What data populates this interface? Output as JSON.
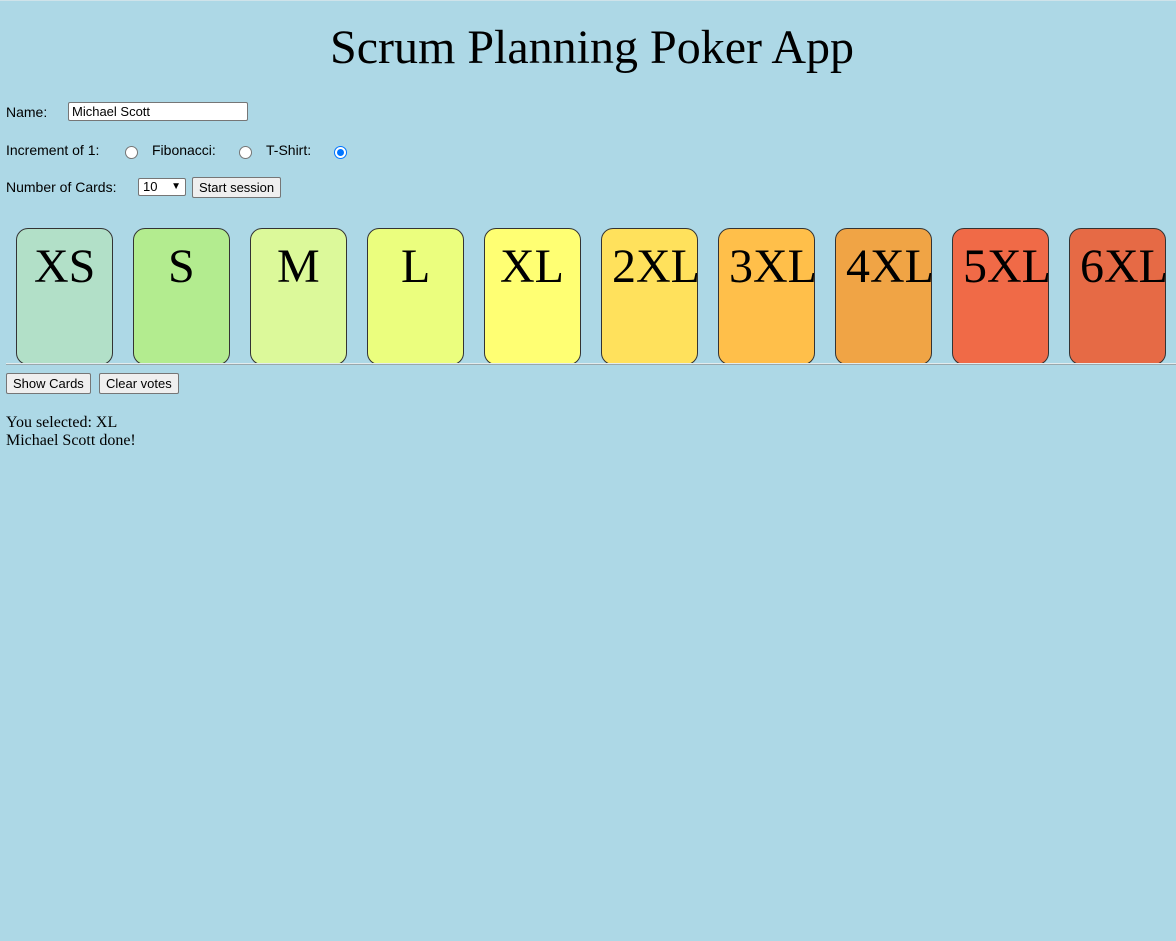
{
  "title": "Scrum Planning Poker App",
  "form": {
    "name_label": "Name:",
    "name_value": "Michael Scott",
    "scale_options": [
      {
        "label": "Increment of 1:",
        "checked": false
      },
      {
        "label": "Fibonacci:",
        "checked": false
      },
      {
        "label": "T-Shirt:",
        "checked": true
      }
    ],
    "count_label": "Number of Cards:",
    "count_value": "10",
    "start_label": "Start session"
  },
  "cards": [
    {
      "label": "XS",
      "color": "#b2e0c8"
    },
    {
      "label": "S",
      "color": "#b3ec8f"
    },
    {
      "label": "M",
      "color": "#dcf99a"
    },
    {
      "label": "L",
      "color": "#ebfe7e"
    },
    {
      "label": "XL",
      "color": "#ffff73"
    },
    {
      "label": "2XL",
      "color": "#ffe15c"
    },
    {
      "label": "3XL",
      "color": "#ffbf4a"
    },
    {
      "label": "4XL",
      "color": "#f0a445"
    },
    {
      "label": "5XL",
      "color": "#f06a47"
    },
    {
      "label": "6XL",
      "color": "#e66a45"
    }
  ],
  "actions": {
    "show_label": "Show Cards",
    "clear_label": "Clear votes"
  },
  "status": {
    "selected_text": "You selected: XL",
    "done_text": "Michael Scott done!"
  }
}
